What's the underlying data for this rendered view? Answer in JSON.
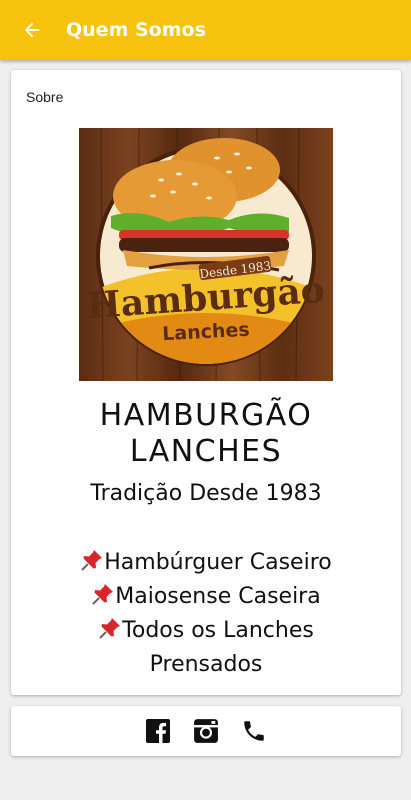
{
  "app_bar": {
    "title": "Quem Somos",
    "back_icon": "arrow-left-icon"
  },
  "colors": {
    "app_bar": "#f7c20e",
    "background": "#efefef",
    "card": "#ffffff"
  },
  "about_card": {
    "label": "Sobre",
    "logo": {
      "text_since": "Desde 1983",
      "text_brand": "Hamburgão",
      "text_sub": "Lanches"
    },
    "brand_name_line1": "HAMBURGÃO",
    "brand_name_line2": "LANCHES",
    "tagline": "Tradição Desde 1983",
    "features": [
      "Hambúrguer Caseiro",
      "Maiosense Caseira",
      "Todos os Lanches",
      "Prensados"
    ],
    "feature_icon": "pushpin-icon"
  },
  "social": [
    {
      "icon": "facebook-icon"
    },
    {
      "icon": "instagram-icon"
    },
    {
      "icon": "phone-icon"
    }
  ]
}
